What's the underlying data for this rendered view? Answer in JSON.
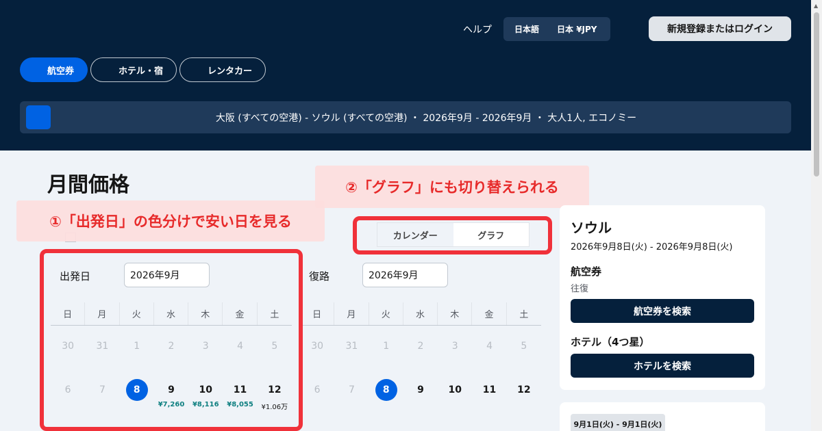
{
  "header": {
    "help": "ヘルプ",
    "language": "日本語",
    "region_currency": "日本 ¥JPY",
    "login": "新規登録またはログイン",
    "tabs": [
      {
        "label": "航空券"
      },
      {
        "label": "ホテル・宿"
      },
      {
        "label": "レンタカー"
      }
    ],
    "search_summary": "大阪 (すべての空港) - ソウル (すべての空港) ・ 2026年9月 - 2026年9月 ・ 大人1人, エコノミー"
  },
  "main": {
    "title": "月間価格",
    "view_toggle": {
      "calendar": "カレンダー",
      "graph": "グラフ"
    },
    "outbound": {
      "label": "出発日",
      "month": "2026年9月"
    },
    "return": {
      "label": "復路",
      "month": "2026年9月"
    },
    "weekdays": [
      "日",
      "月",
      "火",
      "水",
      "木",
      "金",
      "土"
    ],
    "outbound_weeks": [
      [
        {
          "d": "30"
        },
        {
          "d": "31"
        },
        {
          "d": "1"
        },
        {
          "d": "2"
        },
        {
          "d": "3"
        },
        {
          "d": "4"
        },
        {
          "d": "5"
        }
      ],
      [
        {
          "d": "6"
        },
        {
          "d": "7"
        },
        {
          "d": "8",
          "selected": true
        },
        {
          "d": "9",
          "price": "¥7,260"
        },
        {
          "d": "10",
          "price": "¥8,116"
        },
        {
          "d": "11",
          "price": "¥8,055"
        },
        {
          "d": "12",
          "price": "¥1.06万"
        }
      ]
    ],
    "return_weeks": [
      [
        {
          "d": "30"
        },
        {
          "d": "31"
        },
        {
          "d": "1"
        },
        {
          "d": "2"
        },
        {
          "d": "3"
        },
        {
          "d": "4"
        },
        {
          "d": "5"
        }
      ],
      [
        {
          "d": "6"
        },
        {
          "d": "7"
        },
        {
          "d": "8",
          "selected": true
        },
        {
          "d": "9"
        },
        {
          "d": "10"
        },
        {
          "d": "11"
        },
        {
          "d": "12"
        }
      ]
    ]
  },
  "annotations": {
    "one": "①「出発日」の色分けで安い日を見る",
    "two": "②「グラフ」にも切り替えられる"
  },
  "panel": {
    "city": "ソウル",
    "dates": "2026年9月8日(火) - 2026年9月8日(火)",
    "flights_heading": "航空券",
    "flights_sub": "往復",
    "flights_button": "航空券を検索",
    "hotel_heading": "ホテル（4つ星）",
    "hotel_button": "ホテルを検索",
    "next_chip": "9月1日(火) - 9月1日(火)"
  },
  "colors": {
    "header_bg": "#05203c",
    "accent": "#0062e3",
    "cheap_price": "#0e7f80",
    "annotation_red": "#e72a2a"
  }
}
